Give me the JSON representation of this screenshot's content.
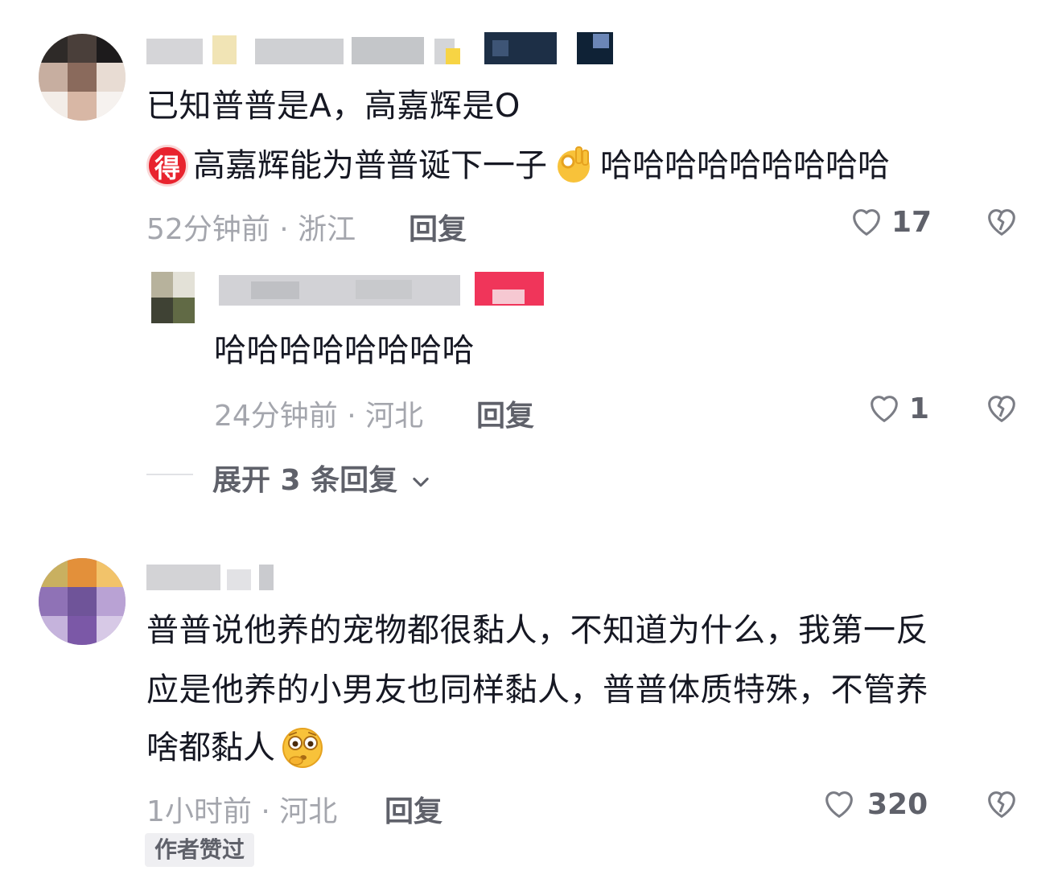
{
  "comments": [
    {
      "text_lines": [
        "已知普普是A，高嘉辉是O",
        "高嘉辉能为普普诞下一子",
        "哈哈哈哈哈哈哈哈哈"
      ],
      "sticker_label": "得",
      "time": "52分钟前",
      "location": "浙江",
      "reply_label": "回复",
      "likes": "17",
      "replies": [
        {
          "text": "哈哈哈哈哈哈哈哈",
          "time": "24分钟前",
          "location": "河北",
          "reply_label": "回复",
          "likes": "1"
        }
      ],
      "expand_label": "展开 3 条回复"
    },
    {
      "text_lines": [
        "普普说他养的宠物都很黏人，不知道为什么，我第一反",
        "应是他养的小男友也同样黏人，普普体质特殊，不管养",
        "啥都黏人"
      ],
      "time": "1小时前",
      "location": "河北",
      "reply_label": "回复",
      "likes": "320",
      "author_badge": "作者赞过"
    }
  ],
  "separator": " · ",
  "icons": {
    "like": "heart-outline-icon",
    "dislike": "broken-heart-icon",
    "expand": "chevron-down-icon",
    "ok_emoji": "ok-hand-emoji",
    "thinking_emoji": "thinking-face-emoji"
  },
  "colors": {
    "primary_text": "#161823",
    "meta_text": "#a4a6ad",
    "action_text": "#5f616a",
    "sticker_red": "#e8232e"
  }
}
